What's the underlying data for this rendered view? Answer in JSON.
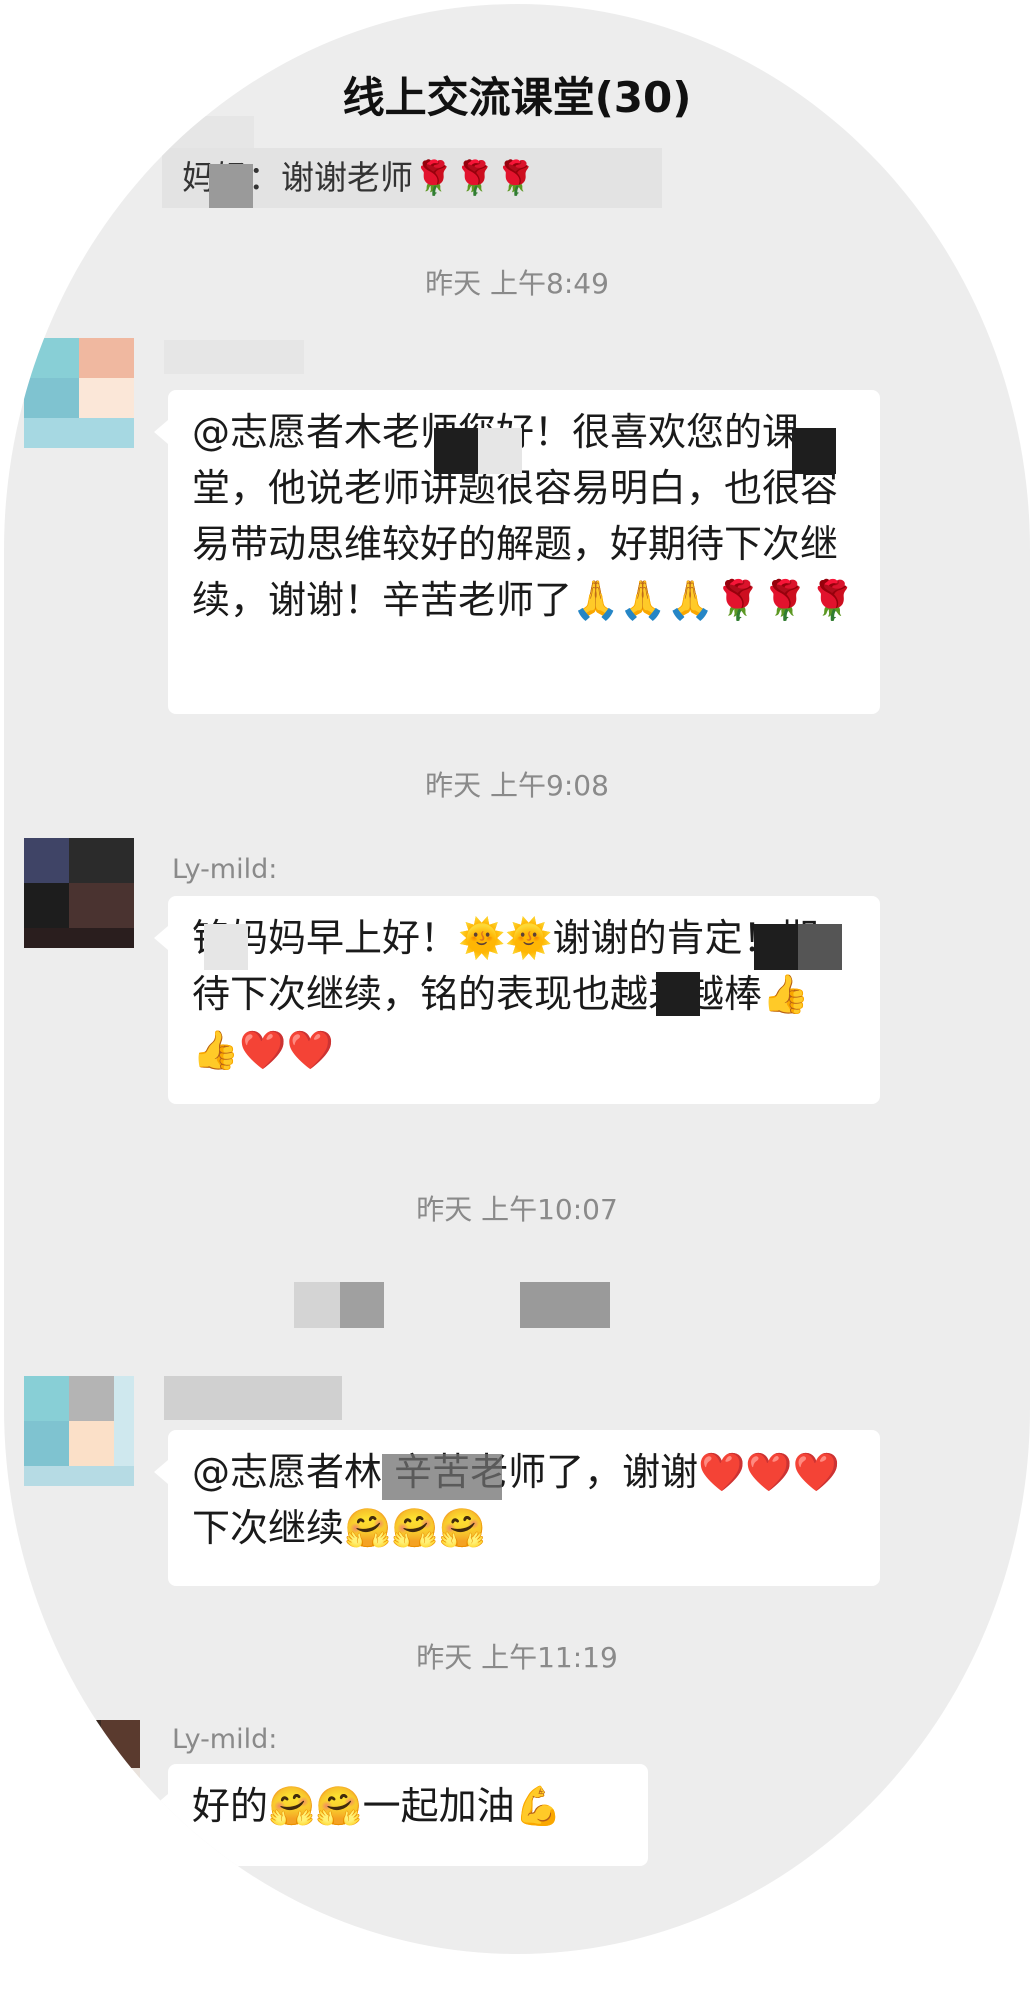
{
  "chat": {
    "title": "线上交流课堂(30)",
    "quoted_text": "妈妈：谢谢老师🌹🌹🌹"
  },
  "messages": [
    {
      "timestamp": "昨天 上午8:49",
      "sender": "",
      "text": "@志愿者木老师您好！很喜欢您的课堂，他说老师讲题很容易明白，也很容易带动思维较好的解题，好期待下次继续，谢谢！辛苦老师了🙏🙏🙏🌹🌹🌹"
    },
    {
      "timestamp": "昨天 上午9:08",
      "sender": "Ly-mild:",
      "text": "铭妈妈早上好！🌞🌞谢谢的肯定！期待下次继续，铭的表现也越来越棒👍👍❤️❤️"
    },
    {
      "timestamp": "昨天 上午10:07",
      "sender": "",
      "text": "@志愿者林 辛苦老师了，谢谢❤️❤️❤️下次继续🤗🤗🤗"
    },
    {
      "timestamp": "昨天 上午11:19",
      "sender": "Ly-mild:",
      "text": "好的🤗🤗一起加油💪"
    }
  ]
}
